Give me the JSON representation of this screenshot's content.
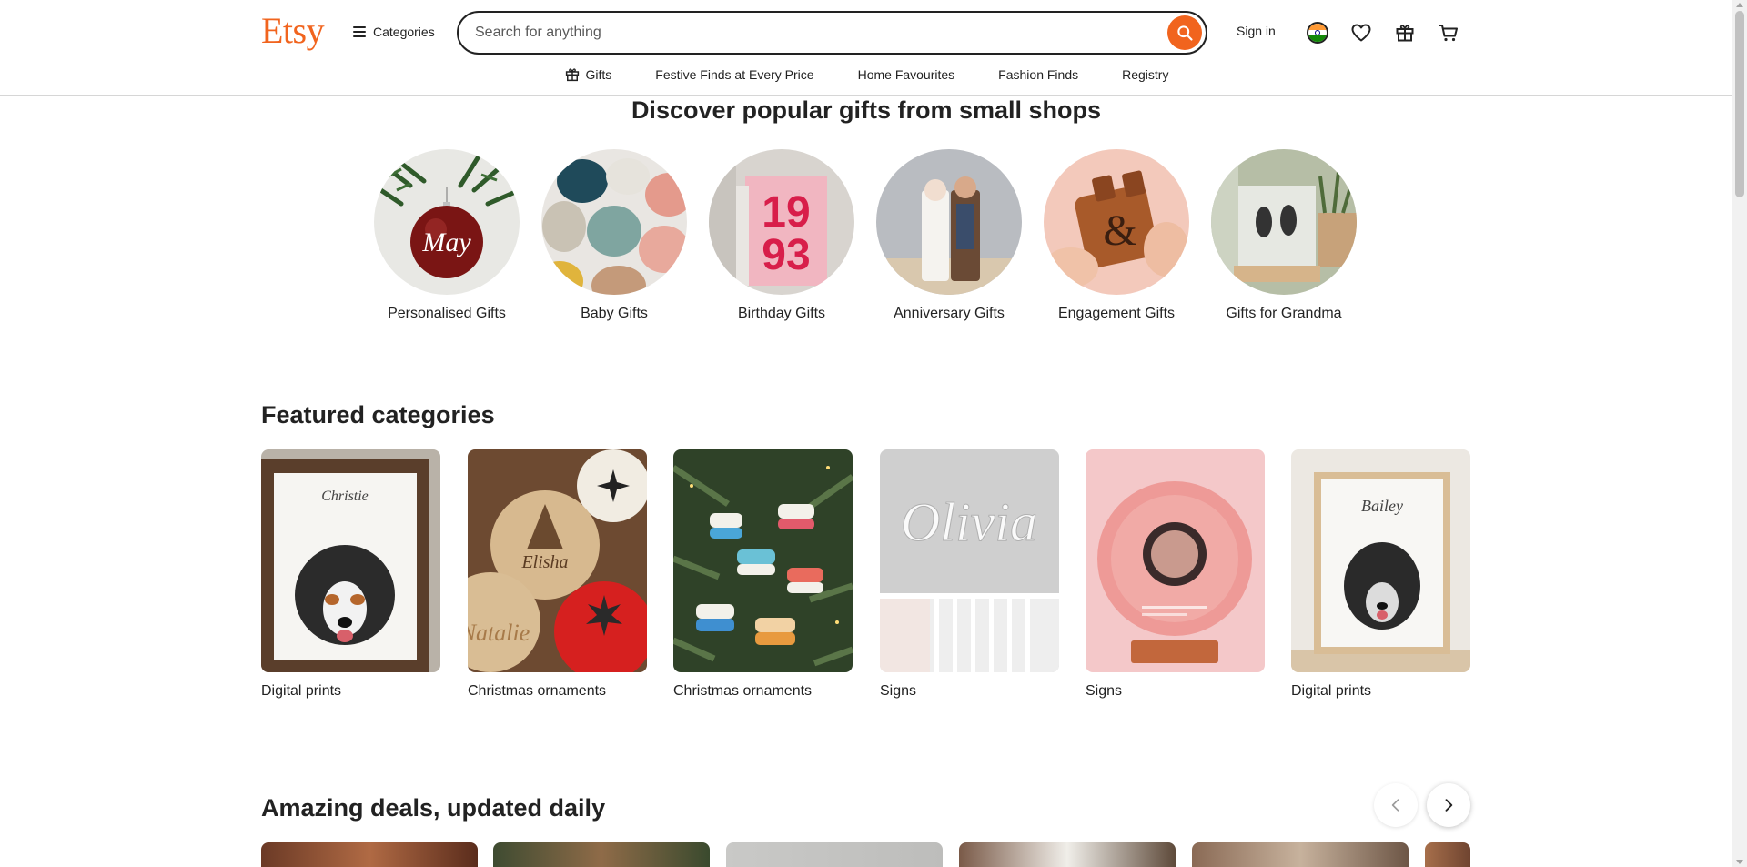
{
  "header": {
    "logo": "Etsy",
    "categories_label": "Categories",
    "search_placeholder": "Search for anything",
    "sign_in": "Sign in",
    "brand_color": "#f1641e",
    "icons": [
      "india-flag-icon",
      "heart-icon",
      "gift-icon",
      "cart-icon"
    ]
  },
  "subnav": {
    "items": [
      {
        "label": "Gifts",
        "icon": "gift-icon"
      },
      {
        "label": "Festive Finds at Every Price"
      },
      {
        "label": "Home Favourites"
      },
      {
        "label": "Fashion Finds"
      },
      {
        "label": "Registry"
      }
    ]
  },
  "popular": {
    "title": "Discover popular gifts from small shops",
    "items": [
      {
        "label": "Personalised Gifts"
      },
      {
        "label": "Baby Gifts"
      },
      {
        "label": "Birthday Gifts"
      },
      {
        "label": "Anniversary Gifts"
      },
      {
        "label": "Engagement Gifts"
      },
      {
        "label": "Gifts for Grandma"
      }
    ]
  },
  "featured": {
    "title": "Featured categories",
    "items": [
      {
        "label": "Digital prints"
      },
      {
        "label": "Christmas ornaments"
      },
      {
        "label": "Christmas ornaments"
      },
      {
        "label": "Signs"
      },
      {
        "label": "Signs"
      },
      {
        "label": "Digital prints"
      }
    ],
    "image_text": {
      "ornament": "May",
      "year_top": "19",
      "year_bottom": "93",
      "sign_name": "Olivia",
      "print1_name": "Christie",
      "print2_name": "Bailey"
    }
  },
  "deals": {
    "title": "Amazing deals, updated daily"
  }
}
